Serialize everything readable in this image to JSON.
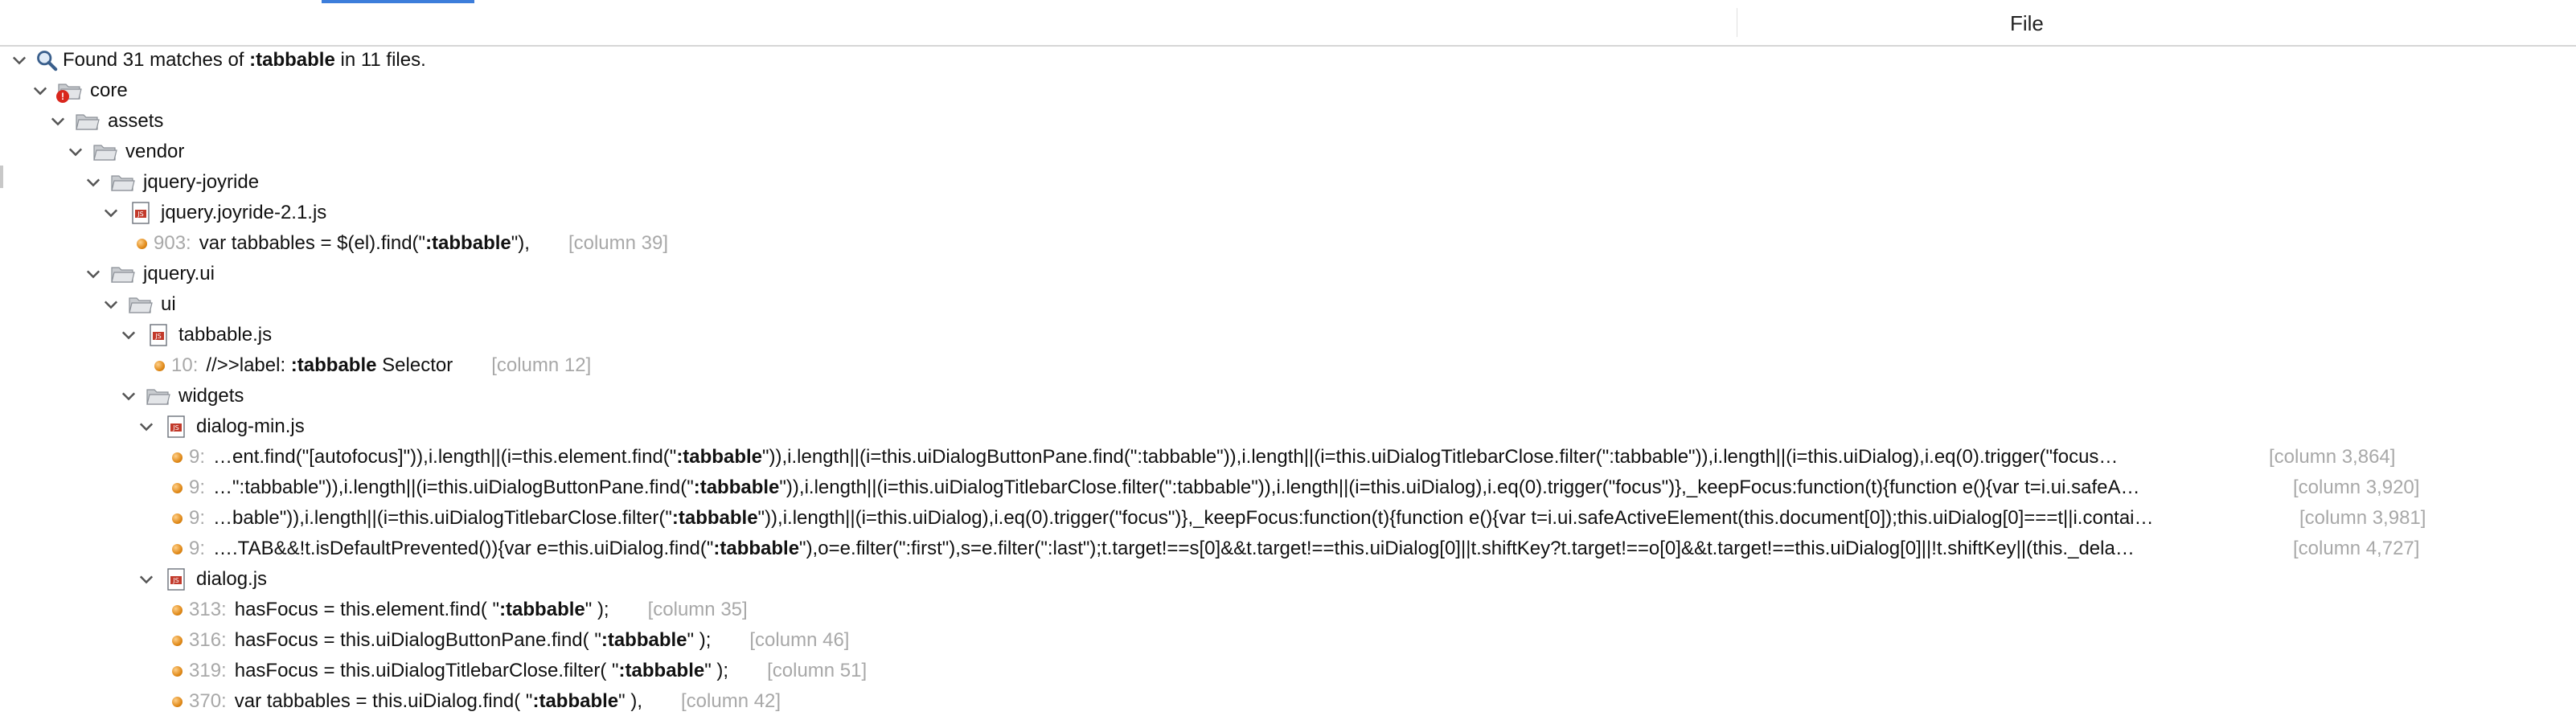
{
  "header": {
    "column_file": "File"
  },
  "summary": {
    "prefix": "Found 31 matches of ",
    "query": ":tabbable",
    "suffix": " in 11 files."
  },
  "tree": {
    "core": "core",
    "assets": "assets",
    "vendor": "vendor",
    "joyride_folder": "jquery-joyride",
    "joyride_file": "jquery.joyride-2.1.js",
    "jqueryui_folder": "jquery.ui",
    "ui_folder": "ui",
    "tabbable_file": "tabbable.js",
    "widgets_folder": "widgets",
    "dialog_min_file": "dialog-min.js",
    "dialog_file": "dialog.js"
  },
  "matches": {
    "joyride": [
      {
        "line": "903:",
        "before": "var tabbables = $(el).find(\"",
        "hit": ":tabbable",
        "after": "\"),",
        "col": "[column 39]"
      }
    ],
    "tabbable": [
      {
        "line": "10:",
        "before": "//>>label: ",
        "hit": ":tabbable",
        "after": " Selector",
        "col": "[column 12]"
      }
    ],
    "dialog_min": [
      {
        "line": "9:",
        "before": "…ent.find(\"[autofocus]\")),i.length||(i=this.element.find(\"",
        "hit": ":tabbable",
        "after": "\")),i.length||(i=this.uiDialogButtonPane.find(\":tabbable\")),i.length||(i=this.uiDialogTitlebarClose.filter(\":tabbable\")),i.length||(i=this.uiDialog),i.eq(0).trigger(\"focus…",
        "col": "[column 3,864]"
      },
      {
        "line": "9:",
        "before": "…\":tabbable\")),i.length||(i=this.uiDialogButtonPane.find(\"",
        "hit": ":tabbable",
        "after": "\")),i.length||(i=this.uiDialogTitlebarClose.filter(\":tabbable\")),i.length||(i=this.uiDialog),i.eq(0).trigger(\"focus\")},_keepFocus:function(t){function e(){var t=i.ui.safeA…",
        "col": "[column 3,920]"
      },
      {
        "line": "9:",
        "before": "…bable\")),i.length||(i=this.uiDialogTitlebarClose.filter(\"",
        "hit": ":tabbable",
        "after": "\")),i.length||(i=this.uiDialog),i.eq(0).trigger(\"focus\")},_keepFocus:function(t){function e(){var t=i.ui.safeActiveElement(this.document[0]);this.uiDialog[0]===t||i.contai…",
        "col": "[column 3,981]"
      },
      {
        "line": "9:",
        "before": "….TAB&&!t.isDefaultPrevented()){var e=this.uiDialog.find(\"",
        "hit": ":tabbable",
        "after": "\"),o=e.filter(\":first\"),s=e.filter(\":last\");t.target!==s[0]&&t.target!==this.uiDialog[0]||t.shiftKey?t.target!==o[0]&&t.target!==this.uiDialog[0]||!t.shiftKey||(this._dela…",
        "col": "[column 4,727]"
      }
    ],
    "dialog": [
      {
        "line": "313:",
        "before": "hasFocus = this.element.find( \"",
        "hit": ":tabbable",
        "after": "\" );",
        "col": "[column 35]"
      },
      {
        "line": "316:",
        "before": "hasFocus = this.uiDialogButtonPane.find( \"",
        "hit": ":tabbable",
        "after": "\" );",
        "col": "[column 46]"
      },
      {
        "line": "319:",
        "before": "hasFocus = this.uiDialogTitlebarClose.filter( \"",
        "hit": ":tabbable",
        "after": "\" );",
        "col": "[column 51]"
      },
      {
        "line": "370:",
        "before": "var tabbables = this.uiDialog.find( \"",
        "hit": ":tabbable",
        "after": "\" ),",
        "col": "[column 42]"
      }
    ]
  },
  "icons": {
    "search": "magnifier-icon",
    "folder": "folder-open-icon",
    "js_file": "js-file-icon",
    "match": "match-dot-icon",
    "error_badge": "error-badge-icon"
  },
  "colors": {
    "accent": "#3d7edb",
    "muted": "#a8a8a8",
    "dot": "#e08a1a",
    "error": "#d9261c"
  }
}
